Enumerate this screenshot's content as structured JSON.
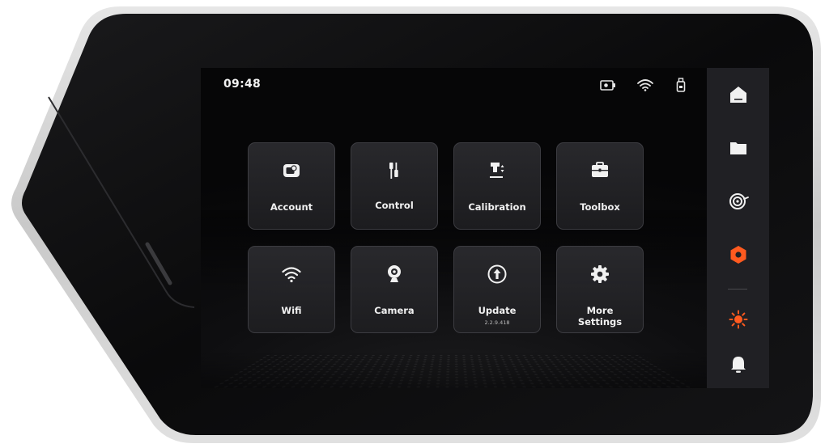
{
  "status_bar": {
    "time": "09:48",
    "icons": [
      "camera-status-icon",
      "wifi-status-icon",
      "usb-drive-icon"
    ]
  },
  "menu": {
    "tiles": [
      {
        "name": "account",
        "label": "Account",
        "icon": "account-icon"
      },
      {
        "name": "control",
        "label": "Control",
        "icon": "sliders-icon"
      },
      {
        "name": "calibration",
        "label": "Calibration",
        "icon": "calibration-icon"
      },
      {
        "name": "toolbox",
        "label": "Toolbox",
        "icon": "toolbox-icon"
      },
      {
        "name": "wifi",
        "label": "Wifi",
        "icon": "wifi-icon"
      },
      {
        "name": "camera",
        "label": "Camera",
        "icon": "webcam-icon"
      },
      {
        "name": "update",
        "label": "Update",
        "sublabel": "2.2.9.418",
        "icon": "upload-arrow-icon"
      },
      {
        "name": "more-settings",
        "label_line1": "More",
        "label_line2": "Settings",
        "icon": "gear-icon"
      }
    ]
  },
  "sidebar": {
    "items": [
      {
        "name": "home",
        "icon": "home-icon",
        "active": false
      },
      {
        "name": "files",
        "icon": "folder-icon",
        "active": false
      },
      {
        "name": "filament",
        "icon": "filament-spool-icon",
        "active": false
      },
      {
        "name": "settings",
        "icon": "hexagon-nut-icon",
        "active": true
      },
      {
        "name": "light",
        "icon": "sun-icon",
        "active": false
      },
      {
        "name": "notifications",
        "icon": "bell-icon",
        "active": false
      }
    ]
  },
  "colors": {
    "accent": "#ff5a1f",
    "screen_bg": "#0b0b0d",
    "tile_bg": "#26262a",
    "tile_border": "#3c3c41",
    "sidebar_bg": "#202024",
    "bezel": "#0d0d0f",
    "bezel_rim": "#d9d9d9",
    "text": "#f1f1f1"
  }
}
